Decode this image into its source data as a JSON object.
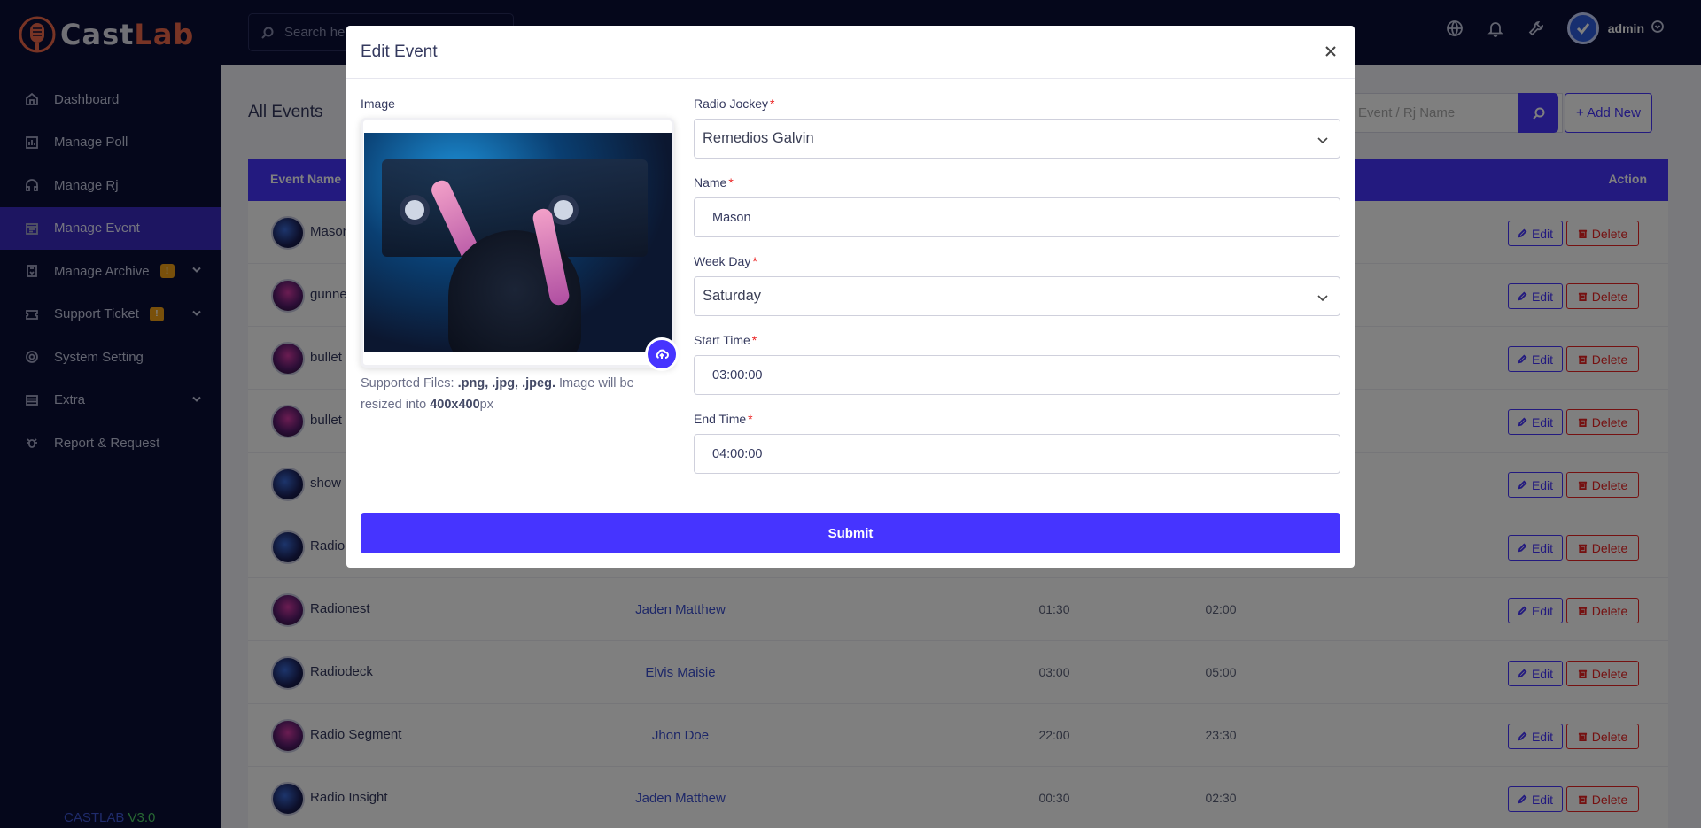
{
  "brand": {
    "cast": "Cast",
    "lab": "Lab",
    "icon": "microphone-logo"
  },
  "sidebar": {
    "items": [
      {
        "label": "Dashboard",
        "icon": "home-icon"
      },
      {
        "label": "Manage Poll",
        "icon": "poll-icon"
      },
      {
        "label": "Manage Rj",
        "icon": "headphones-icon"
      },
      {
        "label": "Manage Event",
        "icon": "calendar-icon",
        "active": true
      },
      {
        "label": "Manage Archive",
        "icon": "archive-icon",
        "badge": "!"
      },
      {
        "label": "Support Ticket",
        "icon": "ticket-icon",
        "badge": "!"
      },
      {
        "label": "System Setting",
        "icon": "settings-icon"
      },
      {
        "label": "Extra",
        "icon": "list-icon"
      },
      {
        "label": "Report & Request",
        "icon": "bug-icon"
      }
    ],
    "footer_brand": "CASTLAB",
    "footer_version": "V3.0"
  },
  "topbar": {
    "search_placeholder": "Search here...",
    "user_name": "admin"
  },
  "page": {
    "title": "All Events",
    "search_placeholder": "Event / Rj Name",
    "add_new_label": "+ Add New",
    "table_headers": {
      "name": "Event Name",
      "action": "Action"
    },
    "edit_label": "Edit",
    "delete_label": "Delete",
    "rows": [
      {
        "name": "Mason",
        "rj": "",
        "start": "",
        "end": "",
        "thumb": "blue"
      },
      {
        "name": "gunner",
        "rj": "",
        "start": "",
        "end": "",
        "thumb": "pink"
      },
      {
        "name": "bullet",
        "rj": "",
        "start": "",
        "end": "",
        "thumb": "pink"
      },
      {
        "name": "bullet",
        "rj": "",
        "start": "",
        "end": "",
        "thumb": "pink"
      },
      {
        "name": "show",
        "rj": "",
        "start": "",
        "end": "",
        "thumb": "blue"
      },
      {
        "name": "Radiola",
        "rj": "",
        "start": "",
        "end": "",
        "thumb": "blue"
      },
      {
        "name": "Radionest",
        "rj": "Jaden Matthew",
        "start": "01:30",
        "end": "02:00",
        "thumb": "pink"
      },
      {
        "name": "Radiodeck",
        "rj": "Elvis Maisie",
        "start": "03:00",
        "end": "05:00",
        "thumb": "blue"
      },
      {
        "name": "Radio Segment",
        "rj": "Jhon Doe",
        "start": "22:00",
        "end": "23:30",
        "thumb": "pink"
      },
      {
        "name": "Radio Insight",
        "rj": "Jaden Matthew",
        "start": "00:30",
        "end": "02:30",
        "thumb": "blue"
      }
    ]
  },
  "modal": {
    "title": "Edit Event",
    "image_label": "Image",
    "help_prefix": "Supported Files: ",
    "help_types": ".png, .jpg, .jpeg.",
    "help_middle": " Image will be resized into ",
    "help_size": "400x400",
    "help_suffix": "px",
    "fields": {
      "rj_label": "Radio Jockey",
      "rj_value": "Remedios Galvin",
      "name_label": "Name",
      "name_value": "Mason",
      "weekday_label": "Week Day",
      "weekday_value": "Saturday",
      "start_label": "Start Time",
      "start_value": "03:00:00",
      "end_label": "End Time",
      "end_value": "04:00:00",
      "required_mark": "*"
    },
    "submit_label": "Submit"
  }
}
